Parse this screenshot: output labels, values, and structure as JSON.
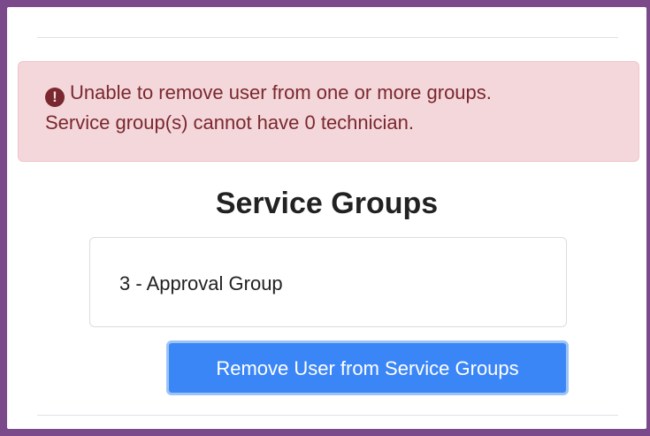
{
  "alert": {
    "icon": "exclamation-circle-icon",
    "message_line1": "Unable to remove user from one or more groups.",
    "message_line2": "Service group(s) cannot have 0 technician.",
    "background_color": "#f4d7da",
    "text_color": "#7a2830"
  },
  "service_groups": {
    "title": "Service Groups",
    "items": [
      {
        "label": "3 - Approval Group"
      }
    ]
  },
  "actions": {
    "remove_button_label": "Remove User from Service Groups",
    "button_color": "#3b86f7"
  },
  "frame": {
    "border_color": "#7a4a8a"
  }
}
